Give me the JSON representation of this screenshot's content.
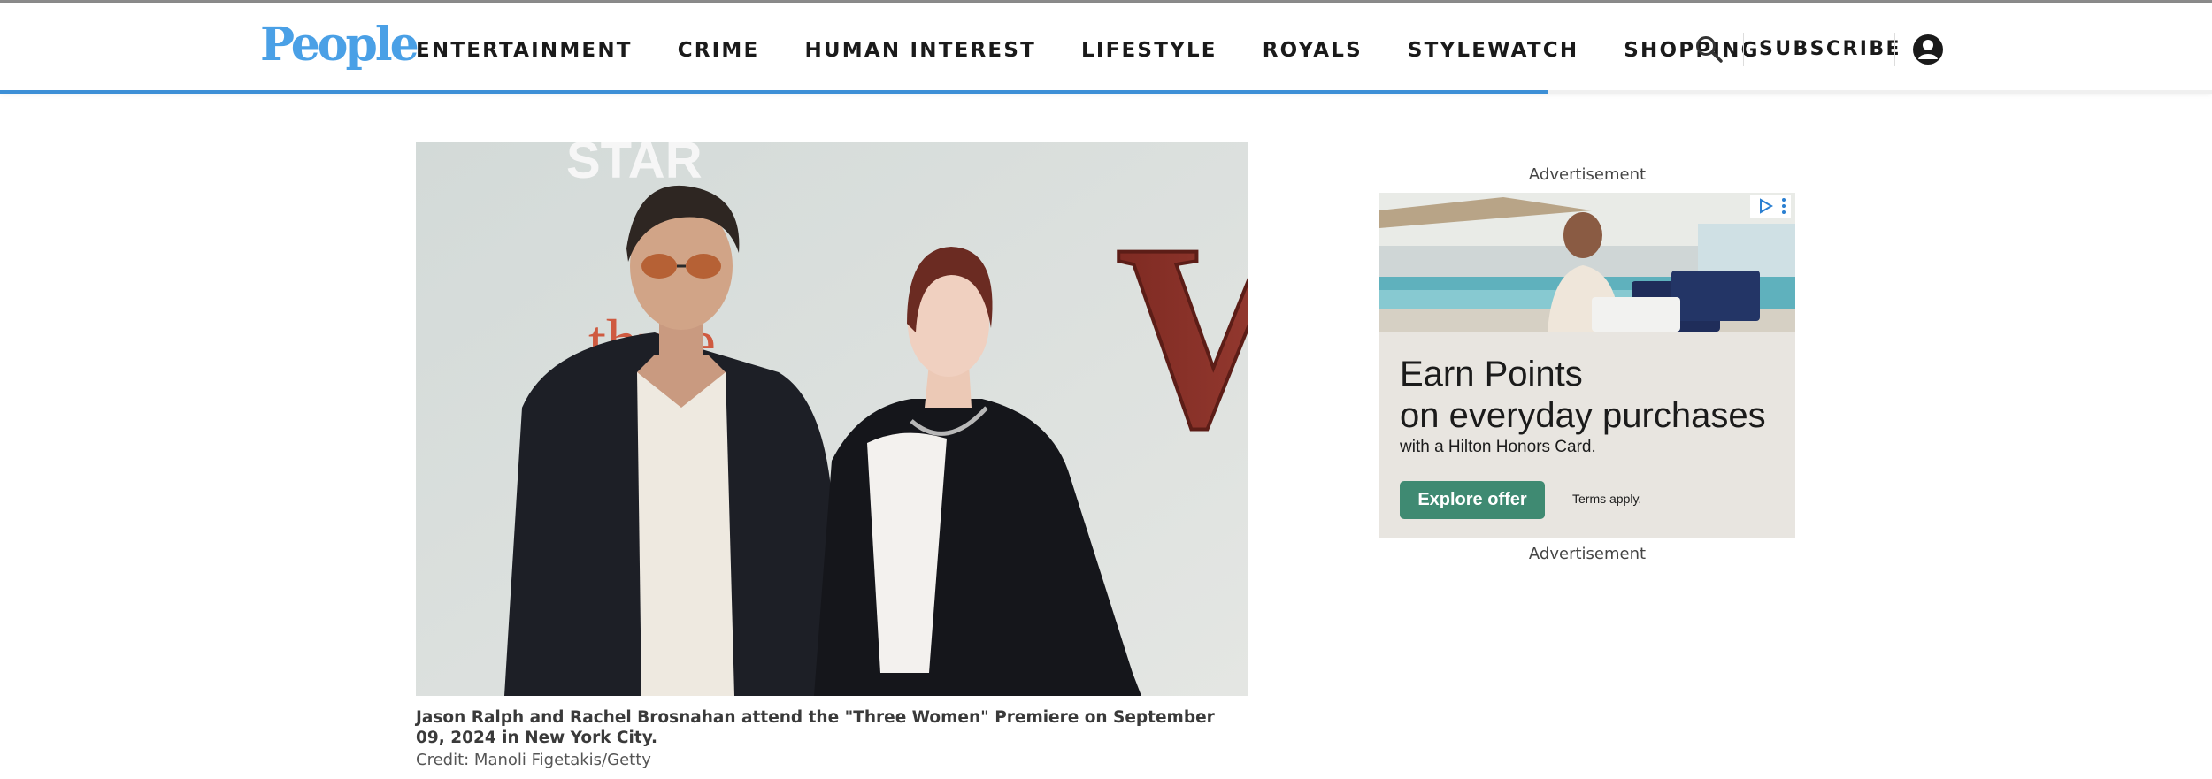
{
  "header": {
    "logo": "People",
    "nav": [
      "ENTERTAINMENT",
      "CRIME",
      "HUMAN INTEREST",
      "LIFESTYLE",
      "ROYALS",
      "STYLEWATCH",
      "SHOPPING"
    ],
    "subscribe_label": "SUBSCRIBE",
    "search_icon": "search-icon",
    "account_icon": "account-icon",
    "reading_progress": 0.7,
    "accent_color": "#3d8fd6",
    "logo_color": "#4aa0e6"
  },
  "article": {
    "photo_backdrop_text": "STAR",
    "photo_backdrop_title": "three",
    "photo_backdrop_letter": "W",
    "caption": "Jason Ralph and Rachel Brosnahan attend the \"Three Women\" Premiere on September 09, 2024 in New York City.",
    "credit": "Credit: Manoli Figetakis/Getty"
  },
  "ad": {
    "label_top": "Advertisement",
    "label_bottom": "Advertisement",
    "headline_line1": "Earn Points",
    "headline_line2": "on everyday purchases",
    "subline": "with a Hilton Honors Card.",
    "cta": "Explore offer",
    "terms": "Terms apply.",
    "cta_color": "#3f8a72",
    "choices_icon": "ad-choices-icon"
  }
}
